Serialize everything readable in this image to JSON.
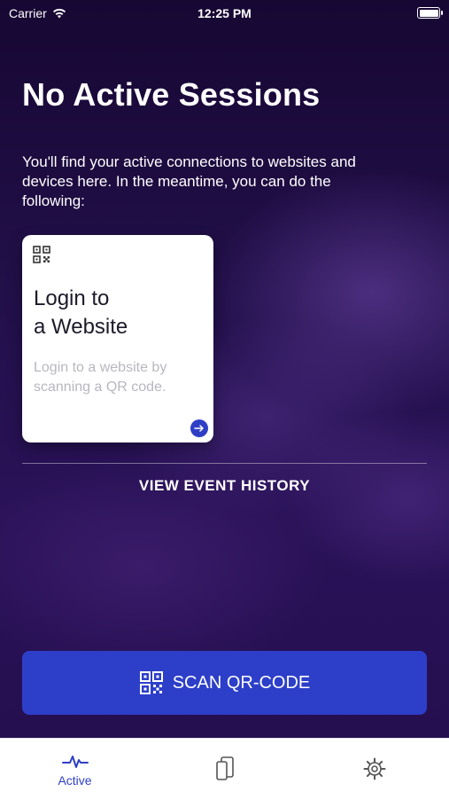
{
  "status_bar": {
    "carrier": "Carrier",
    "time": "12:25 PM",
    "icons": [
      "wifi-icon",
      "battery-icon"
    ]
  },
  "header": {
    "title": "No Active Sessions",
    "description": "You'll find your active connections to websites and devices here. In the meantime, you can do the following:"
  },
  "card": {
    "icon": "qr-code-icon",
    "title_line1": "Login to",
    "title_line2": "a Website",
    "subtitle": "Login to a website by scanning a QR code.",
    "action_icon": "arrow-right-circle-icon"
  },
  "history_link": "VIEW EVENT HISTORY",
  "scan_button": {
    "label": "SCAN QR-CODE",
    "icon": "qr-scan-icon"
  },
  "tabbar": {
    "tabs": [
      {
        "label": "Active",
        "icon": "pulse-icon",
        "selected": true
      },
      {
        "label": "",
        "icon": "devices-icon",
        "selected": false
      },
      {
        "label": "",
        "icon": "gear-icon",
        "selected": false
      }
    ]
  },
  "colors": {
    "background": "#1c0b3e",
    "accent": "#2d3fc9",
    "card_bg": "#ffffff"
  }
}
